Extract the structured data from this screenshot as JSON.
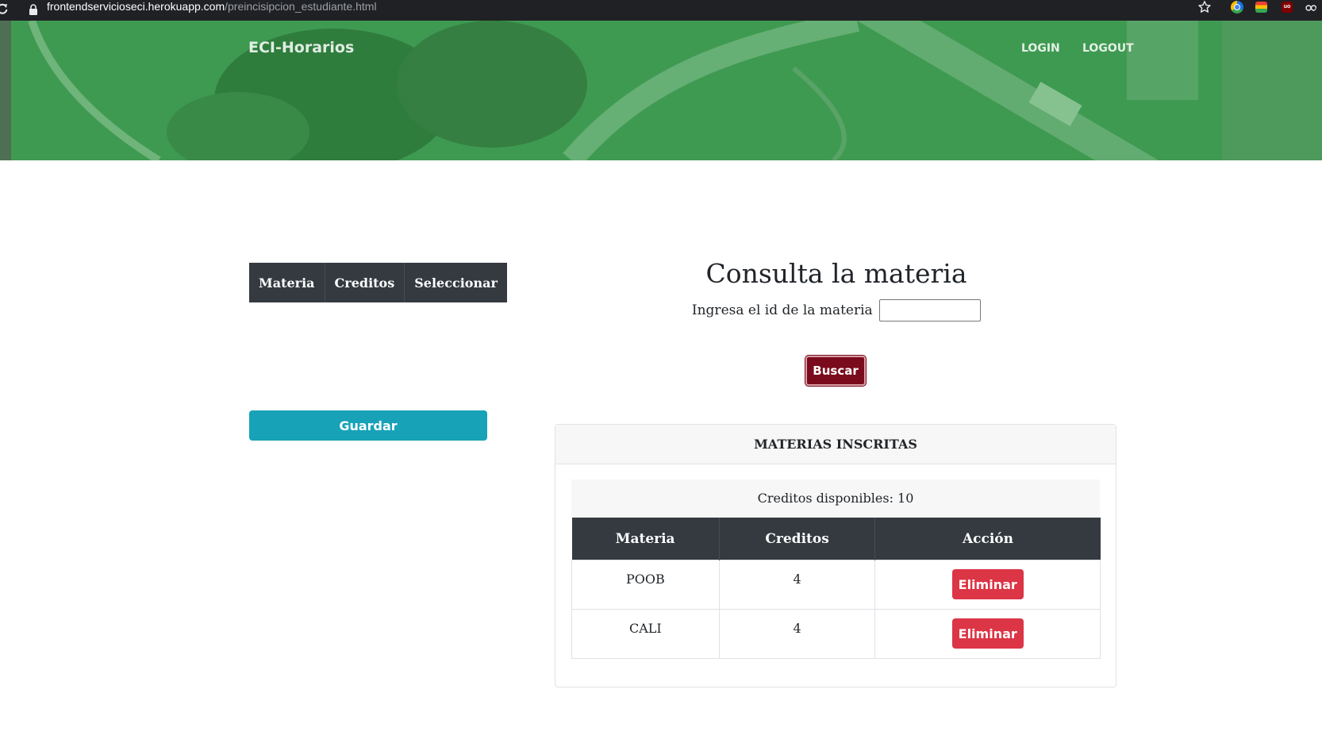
{
  "browser": {
    "url_host": "frontendservicioseci.herokuapp.com",
    "url_path": "/preincisipcion_estudiante.html"
  },
  "navbar": {
    "brand": "ECI-Horarios",
    "login": "LOGIN",
    "logout": "LOGOUT"
  },
  "selection_table": {
    "headers": [
      "Materia",
      "Creditos",
      "Seleccionar"
    ]
  },
  "save_button": "Guardar",
  "search": {
    "heading": "Consulta la materia",
    "label": "Ingresa el id de la materia",
    "value": "",
    "button": "Buscar"
  },
  "enrolled": {
    "title": "MATERIAS INSCRITAS",
    "credits_label": "Creditos disponibles: 10",
    "headers": [
      "Materia",
      "Creditos",
      "Acción"
    ],
    "rows": [
      {
        "materia": "POOB",
        "creditos": "4",
        "action": "Eliminar"
      },
      {
        "materia": "CALI",
        "creditos": "4",
        "action": "Eliminar"
      }
    ]
  },
  "colors": {
    "navbar_green": "#3e9c52",
    "table_dark": "#343a40",
    "save_teal": "#17a2b8",
    "search_maroon": "#7a0b1c",
    "delete_red": "#dc3545"
  }
}
